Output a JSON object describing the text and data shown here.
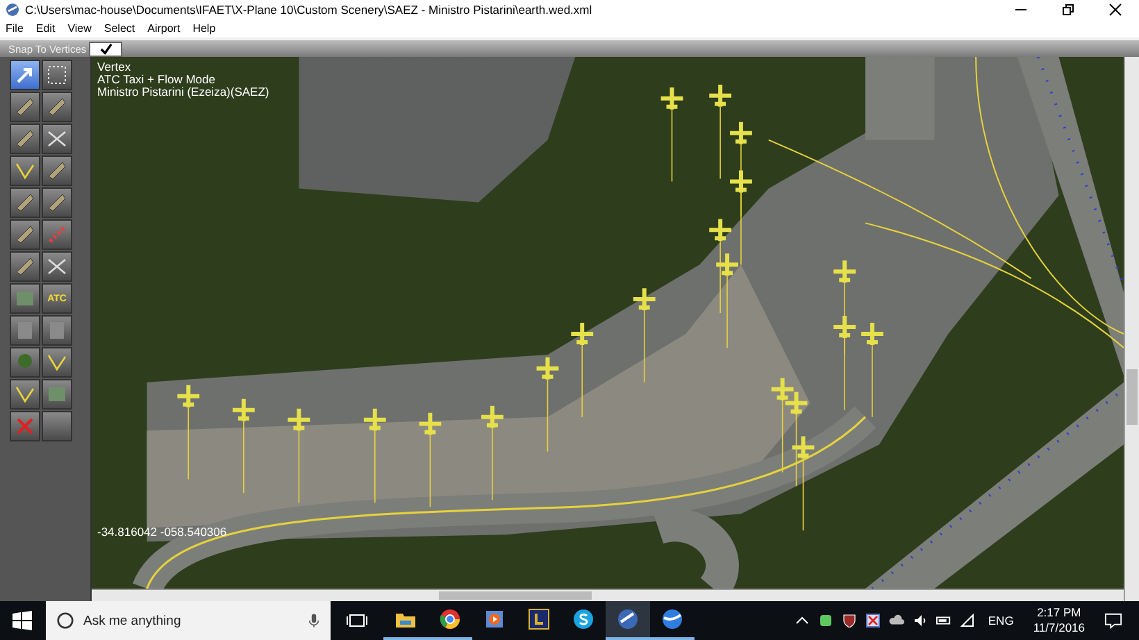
{
  "window": {
    "title": "C:\\Users\\mac-house\\Documents\\IFAET\\X-Plane 10\\Custom Scenery\\SAEZ - Ministro Pistarini\\earth.wed.xml"
  },
  "menu": [
    "File",
    "Edit",
    "View",
    "Select",
    "Airport",
    "Help"
  ],
  "toolbar": {
    "snap_label": "Snap To Vertices",
    "snap_checked": true
  },
  "tools": [
    {
      "selected": true
    },
    {
      "selected": false
    },
    {
      "selected": false
    },
    {
      "selected": false
    },
    {
      "selected": false
    },
    {
      "selected": false
    },
    {
      "selected": false
    },
    {
      "selected": false
    },
    {
      "selected": false
    },
    {
      "selected": false
    },
    {
      "selected": false
    },
    {
      "selected": false
    },
    {
      "selected": false
    },
    {
      "selected": false
    },
    {
      "selected": false
    },
    {
      "label": "ATC",
      "selected": false
    },
    {
      "selected": false
    },
    {
      "selected": false
    },
    {
      "selected": false
    },
    {
      "selected": false
    },
    {
      "selected": false
    },
    {
      "selected": false
    },
    {
      "selected": false
    },
    {
      "selected": false
    }
  ],
  "map": {
    "info": [
      "Vertex",
      "ATC Taxi + Flow Mode",
      "Ministro Pistarini (Ezeiza)(SAEZ)"
    ],
    "coordinates": "-34.816042 -058.540306"
  },
  "taskbar": {
    "search_placeholder": "Ask me anything",
    "apps": [
      {
        "kind": "explorer",
        "running": true,
        "selected": false
      },
      {
        "kind": "chrome",
        "running": true,
        "selected": false
      },
      {
        "kind": "media",
        "running": false,
        "selected": false
      },
      {
        "kind": "book",
        "running": false,
        "selected": false
      },
      {
        "kind": "skype",
        "running": false,
        "selected": false
      },
      {
        "kind": "wed",
        "running": true,
        "selected": true
      },
      {
        "kind": "earth",
        "running": true,
        "selected": false
      }
    ],
    "language": "ENG",
    "time": "2:17 PM",
    "date": "11/7/2016"
  }
}
